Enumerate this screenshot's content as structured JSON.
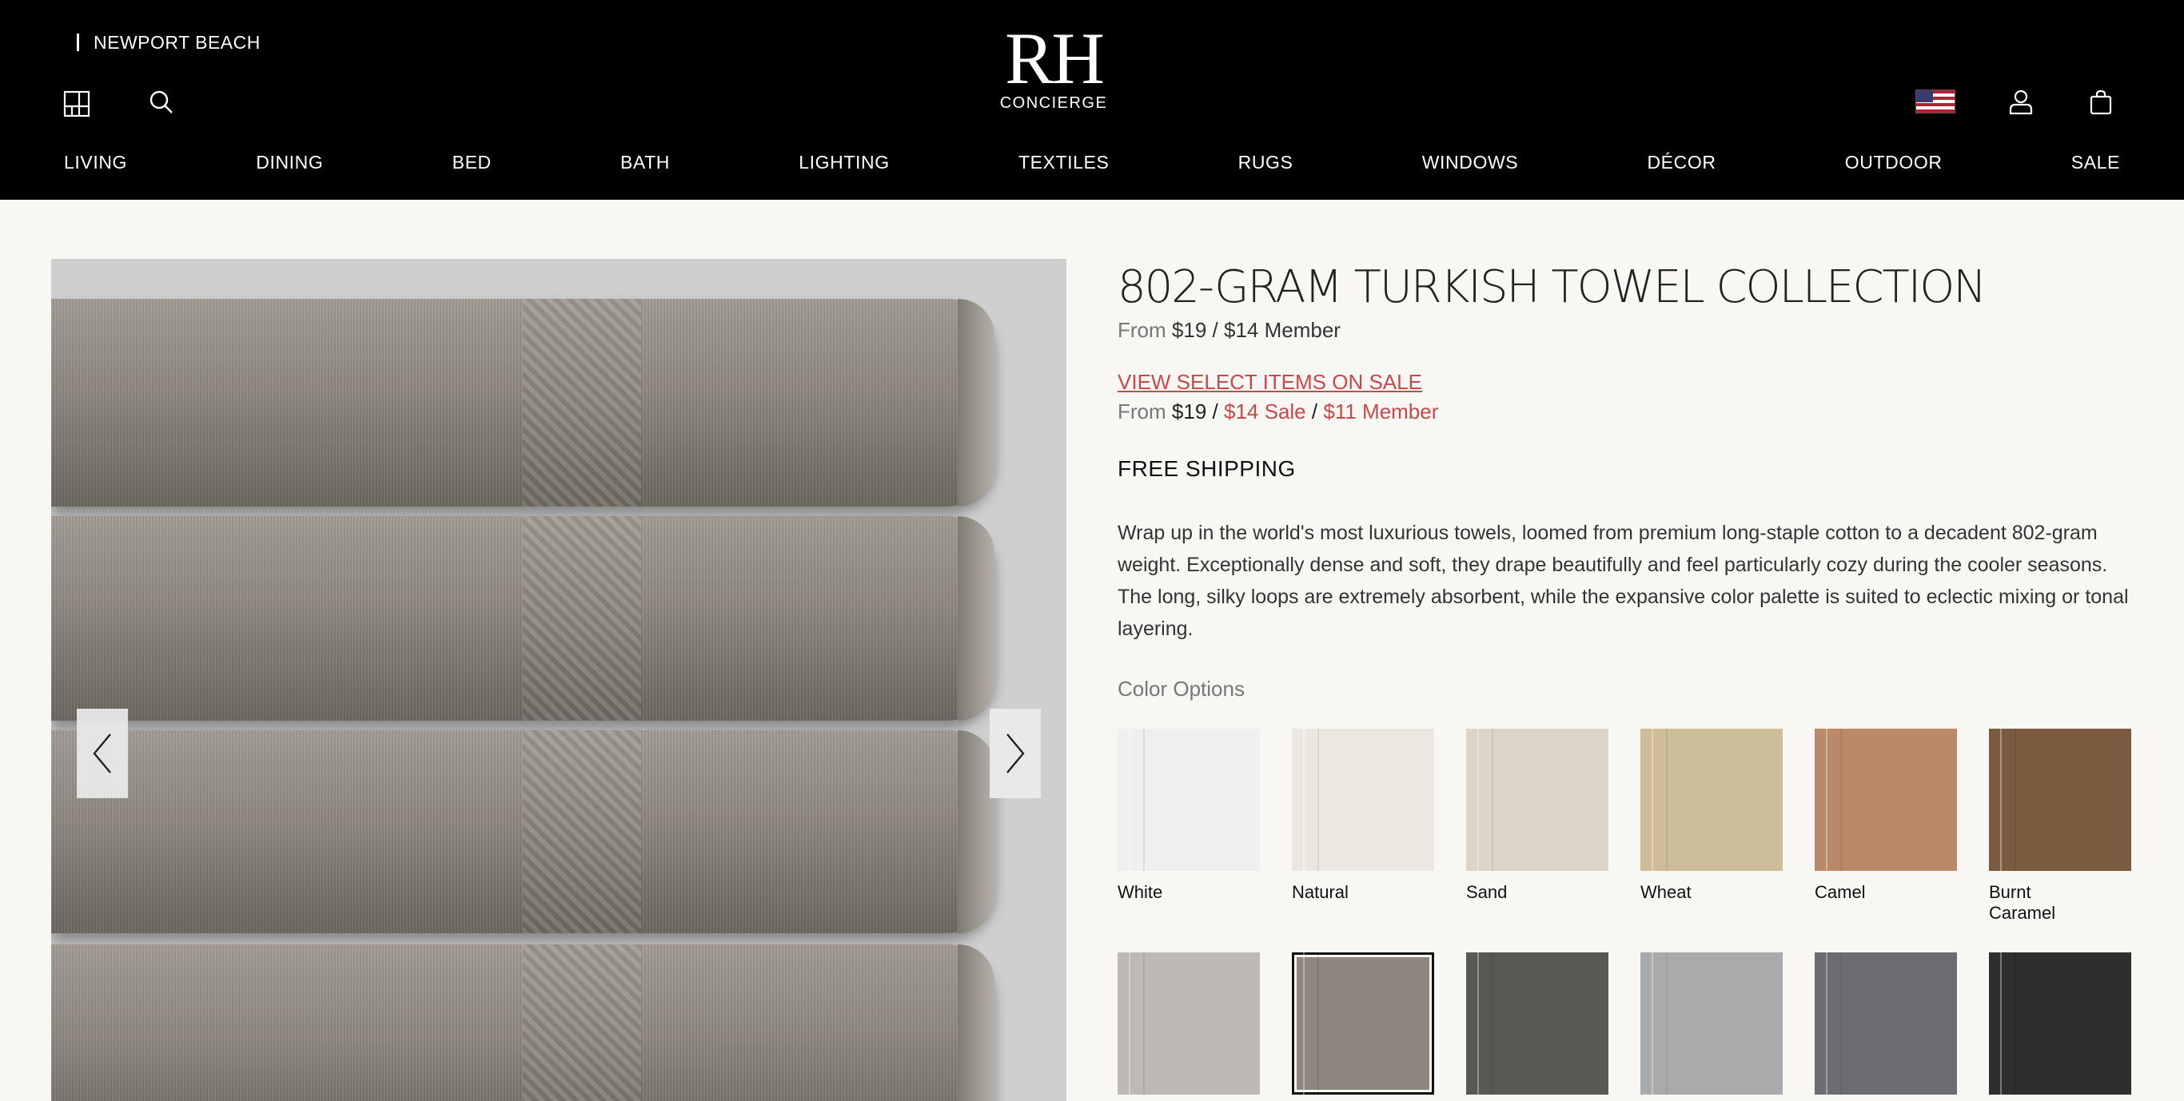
{
  "header": {
    "location": "NEWPORT BEACH",
    "logo_mark": "RH",
    "logo_sub": "CONCIERGE",
    "nav": [
      "LIVING",
      "DINING",
      "BED",
      "BATH",
      "LIGHTING",
      "TEXTILES",
      "RUGS",
      "WINDOWS",
      "DÉCOR",
      "OUTDOOR",
      "SALE"
    ]
  },
  "product": {
    "title": "802-GRAM TURKISH TOWEL COLLECTION",
    "price_from_label": "From",
    "price_regular": "$19",
    "price_sep": "/",
    "price_member": "$14 Member",
    "sale_link": "VIEW SELECT ITEMS ON SALE",
    "sale_from_label": "From",
    "sale_regular": "$19",
    "sale_sep1": "/",
    "sale_sale": "$14 Sale",
    "sale_sep2": "/",
    "sale_member": "$11 Member",
    "shipping": "FREE SHIPPING",
    "description": "Wrap up in the world's most luxurious towels, loomed from premium long-staple cotton to a decadent 802-gram weight. Exceptionally dense and soft, they drape beautifully and feel particularly cozy during the cooler seasons. The long, silky loops are extremely absorbent, while the expansive color palette is suited to eclectic mixing or tonal layering.",
    "color_options_label": "Color Options",
    "colors": [
      {
        "name": "White",
        "hex": "#efefef"
      },
      {
        "name": "Natural",
        "hex": "#ebe8e2"
      },
      {
        "name": "Sand",
        "hex": "#ddd6c8"
      },
      {
        "name": "Wheat",
        "hex": "#cdbd98"
      },
      {
        "name": "Camel",
        "hex": "#b9896a"
      },
      {
        "name": "Burnt Caramel",
        "hex": "#7a5b3f"
      },
      {
        "name": "",
        "hex": "#bdbab5"
      },
      {
        "name": "",
        "hex": "#8e8780"
      },
      {
        "name": "",
        "hex": "#5a5855"
      },
      {
        "name": "",
        "hex": "#a9aaac"
      },
      {
        "name": "",
        "hex": "#6c6d70"
      },
      {
        "name": "",
        "hex": "#2e2e2f"
      }
    ],
    "selected_color_index": 7
  },
  "icons": {
    "rooms": "floorplan-icon",
    "search": "search-icon",
    "flag": "us-flag-icon",
    "account": "account-icon",
    "cart": "shopping-bag-icon",
    "prev": "chevron-left-icon",
    "next": "chevron-right-icon"
  }
}
